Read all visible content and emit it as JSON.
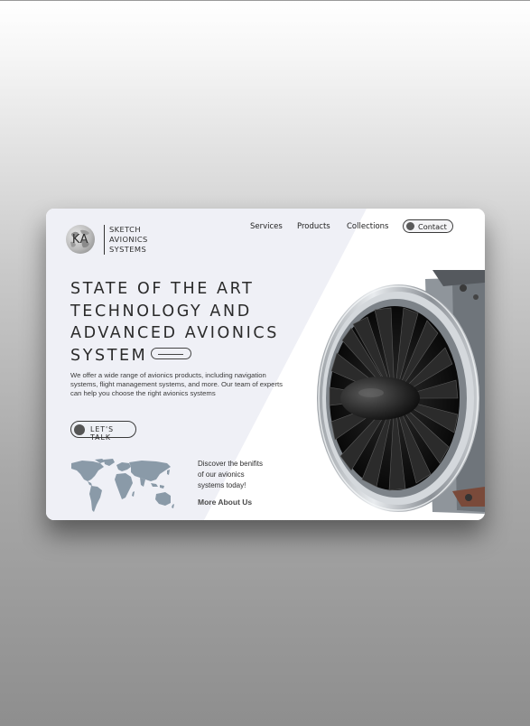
{
  "brand": {
    "initials": "KA",
    "name_lines": [
      "SKETCH",
      "AVIONICS",
      "SYSTEMS"
    ],
    "logo_icon": "globe-icon"
  },
  "nav": {
    "links": [
      "Services",
      "Products",
      "Collections"
    ],
    "contact_label": "Contact"
  },
  "hero": {
    "headline_lines": [
      "STATE OF THE ART",
      "TECHNOLOGY AND",
      "ADVANCED AVIONICS",
      "SYSTEM"
    ],
    "description": "We offer a wide range of avionics products, including navigation systems, flight management systems, and more. Our team of experts can help you choose the right avionics systems",
    "cta_label": "LET'S TALK"
  },
  "discover": {
    "lines": [
      "Discover the benifits",
      "of our avionics",
      "systems today!"
    ],
    "link_label": "More About Us"
  },
  "colors": {
    "panel_tint": "#eff0f6",
    "map_fill": "#8a9aa8",
    "text_dark": "#2a2a2a",
    "engine_fan": "#1a1a1a"
  }
}
